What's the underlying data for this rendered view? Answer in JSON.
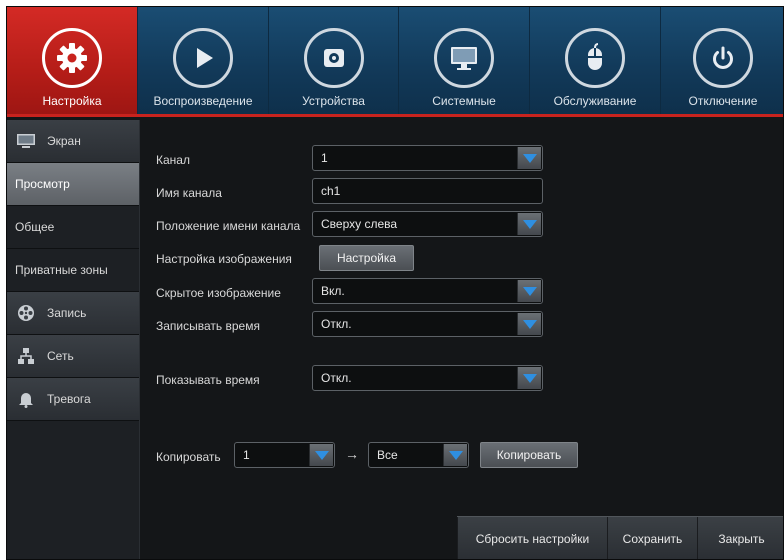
{
  "top_menu": [
    {
      "label": "Настройка",
      "icon": "gear-icon",
      "active": true
    },
    {
      "label": "Воспроизведение",
      "icon": "play-icon",
      "active": false
    },
    {
      "label": "Устройства",
      "icon": "device-icon",
      "active": false
    },
    {
      "label": "Системные",
      "icon": "monitor-icon",
      "active": false
    },
    {
      "label": "Обслуживание",
      "icon": "mouse-icon",
      "active": false
    },
    {
      "label": "Отключение",
      "icon": "power-icon",
      "active": false
    }
  ],
  "sidebar": [
    {
      "label": "Экран",
      "type": "category",
      "icon": "monitor-icon"
    },
    {
      "label": "Просмотр",
      "type": "selected"
    },
    {
      "label": "Общее",
      "type": "sub"
    },
    {
      "label": "Приватные зоны",
      "type": "sub"
    },
    {
      "label": "Запись",
      "type": "category",
      "icon": "film-reel-icon"
    },
    {
      "label": "Сеть",
      "type": "category",
      "icon": "network-icon"
    },
    {
      "label": "Тревога",
      "type": "category",
      "icon": "alarm-bell-icon"
    }
  ],
  "form": {
    "channel": {
      "label": "Канал",
      "value": "1"
    },
    "channel_name": {
      "label": "Имя канала",
      "value": "ch1"
    },
    "name_position": {
      "label": "Положение имени канала",
      "value": "Сверху слева"
    },
    "image_settings": {
      "label": "Настройка изображения",
      "button": "Настройка"
    },
    "hidden_image": {
      "label": "Скрытое изображение",
      "value": "Вкл."
    },
    "record_time": {
      "label": "Записывать время",
      "value": "Откл."
    },
    "show_time": {
      "label": "Показывать время",
      "value": "Откл."
    }
  },
  "copy": {
    "label": "Копировать",
    "from_value": "1",
    "arrow": "→",
    "to_value": "Все",
    "button": "Копировать"
  },
  "footer": {
    "reset": "Сбросить настройки",
    "save": "Сохранить",
    "close": "Закрыть"
  },
  "colors": {
    "active_tab": "#c8231e",
    "top_bar": "#123a5a",
    "dropdown_arrow": "#2f8fe0"
  }
}
